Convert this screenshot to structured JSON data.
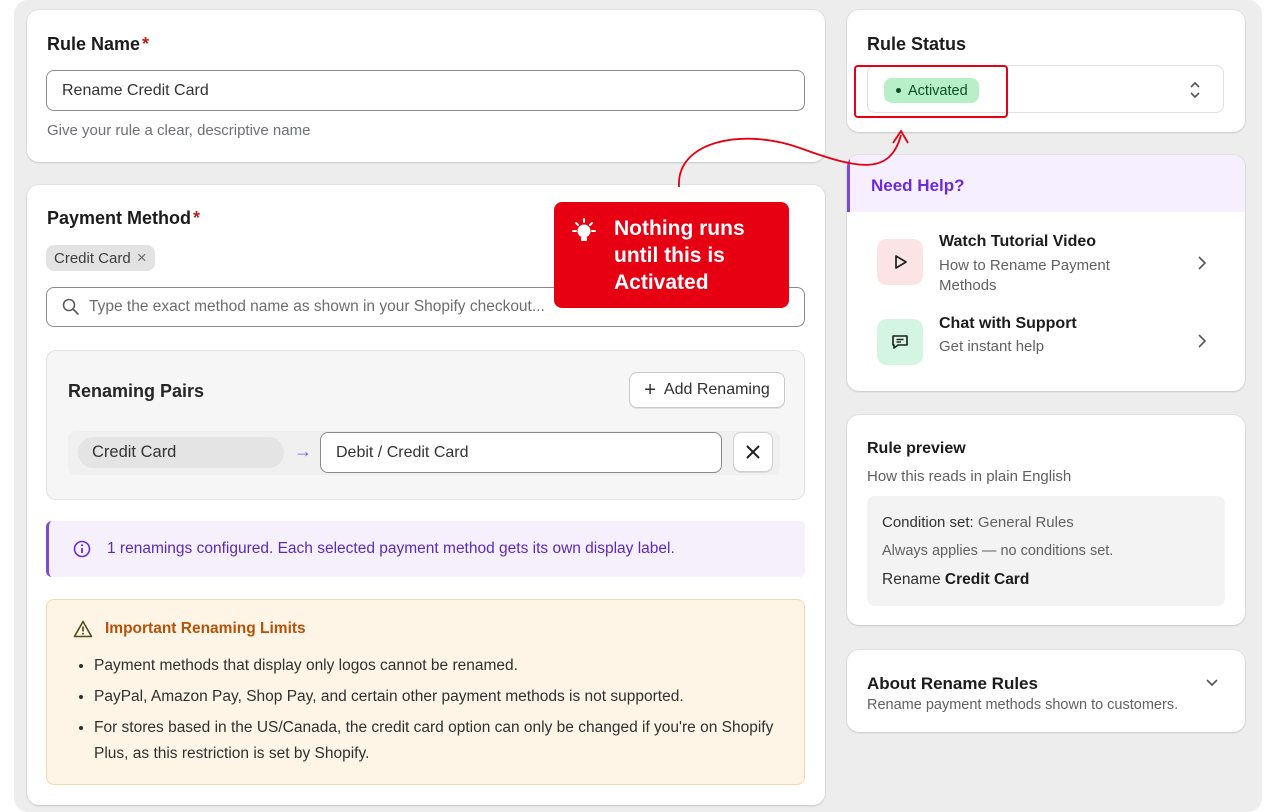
{
  "rule_name": {
    "label": "Rule Name",
    "required_mark": "*",
    "value": "Rename Credit Card",
    "hint": "Give your rule a clear, descriptive name"
  },
  "payment_method": {
    "label": "Payment Method",
    "required_mark": "*",
    "chip": "Credit Card",
    "chip_remove": "×",
    "search_placeholder": "Type the exact method name as shown in your Shopify checkout..."
  },
  "renaming_pairs": {
    "title": "Renaming Pairs",
    "add_button": "Add Renaming",
    "pairs": [
      {
        "from": "Credit Card",
        "arrow": "→",
        "to": "Debit / Credit Card"
      }
    ]
  },
  "info_banner": {
    "text": "1 renamings configured. Each selected payment method gets its own display label."
  },
  "limits": {
    "title": "Important Renaming Limits",
    "items": [
      "Payment methods that display only logos cannot be renamed.",
      "PayPal, Amazon Pay, Shop Pay, and certain other payment methods is not supported.",
      "For stores based in the US/Canada, the credit card option can only be changed if you're on Shopify Plus, as this restriction is set by Shopify."
    ]
  },
  "rule_status": {
    "label": "Rule Status",
    "value": "Activated"
  },
  "callout": {
    "text": "Nothing runs until this is Activated"
  },
  "help": {
    "title": "Need Help?",
    "items": [
      {
        "title": "Watch Tutorial Video",
        "subtitle": "How to Rename Payment Methods",
        "icon": "play-icon"
      },
      {
        "title": "Chat with Support",
        "subtitle": "Get instant help",
        "icon": "chat-icon"
      }
    ]
  },
  "preview": {
    "title": "Rule preview",
    "subtitle": "How this reads in plain English",
    "condition_label": "Condition set:",
    "condition_value": "General Rules",
    "applies": "Always applies — no conditions set.",
    "action_prefix": "Rename",
    "action_target": "Credit Card"
  },
  "about": {
    "title": "About Rename Rules",
    "subtitle": "Rename payment methods shown to customers."
  },
  "colors": {
    "accent_purple": "#6c2bd9",
    "callout_red": "#e60012",
    "status_green_bg": "#b7f0c8",
    "warning_orange": "#b45309"
  }
}
